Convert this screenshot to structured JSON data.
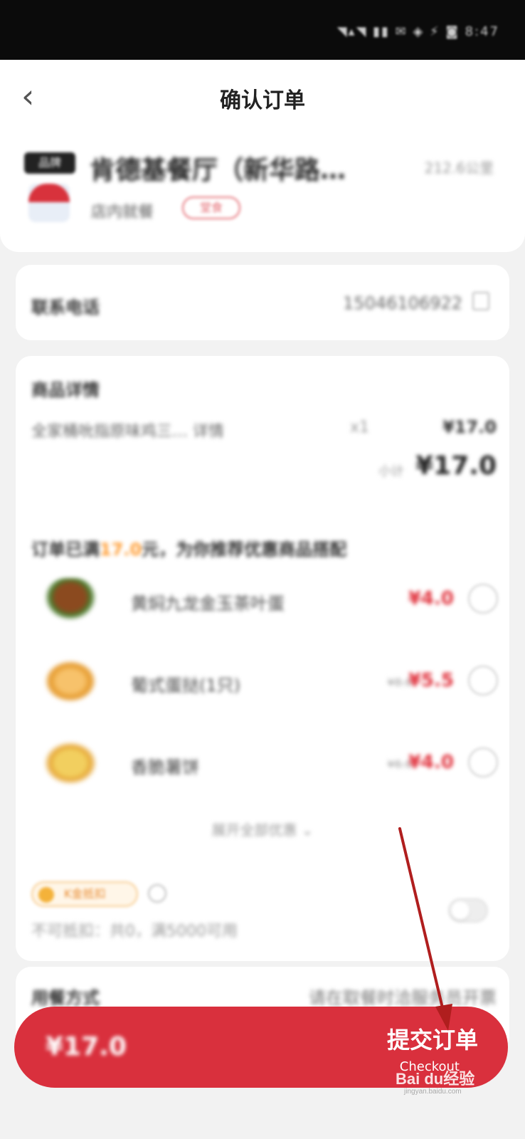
{
  "status_bar": {
    "icons": "◥▴◥ ▮▮ ✉ ◈ ⚡ ◙ 8:47"
  },
  "header": {
    "title": "确认订单",
    "store_tag": "品牌",
    "store_name": "肯德基餐厅（新华路…",
    "distance": "212.6公里",
    "dine_mode": "店内就餐",
    "dine_badge": "堂食"
  },
  "contact": {
    "label": "联系电话",
    "value": "15046106922"
  },
  "goods": {
    "section_title": "商品详情",
    "item_name": "全家桶吮指原味鸡三…",
    "item_spec": "详情",
    "item_qty": "x1",
    "item_price": "¥17.0",
    "subtotal_label": "小计",
    "subtotal_value": "¥17.0"
  },
  "recommend": {
    "title_prefix": "订单已满",
    "title_amount": "17.0",
    "title_suffix": "元，为你推荐优惠商品搭配",
    "items": [
      {
        "name": "黄焖九龙金玉茶叶蛋",
        "old_price": "",
        "price": "¥4.0"
      },
      {
        "name": "葡式蛋挞(1只)",
        "old_price": "¥8.0",
        "price": "¥5.5"
      },
      {
        "name": "香脆薯饼",
        "old_price": "¥6.0",
        "price": "¥4.0"
      }
    ],
    "expand_label": "展开全部优惠 ⌄"
  },
  "coins": {
    "badge_label": "K金抵扣",
    "note": "不可抵扣：共0，满5000可用"
  },
  "dining": {
    "label": "用餐方式",
    "value": "请在取餐时洽服务员开票"
  },
  "bottom": {
    "total": "¥17.0",
    "submit_label": "提交订单",
    "checkout_label": "Checkout"
  },
  "watermark": {
    "brand": "Bai du经验",
    "url": "jingyan.baidu.com"
  },
  "colors": {
    "brand_red": "#d9303d",
    "price_red": "#e0303b",
    "highlight_orange": "#ff9a2e",
    "arrow": "#b01e1e"
  },
  "icons": [
    "back-arrow-icon",
    "edit-icon",
    "info-icon",
    "coin-icon",
    "chevron-down-icon",
    "annotation-arrow-icon"
  ]
}
